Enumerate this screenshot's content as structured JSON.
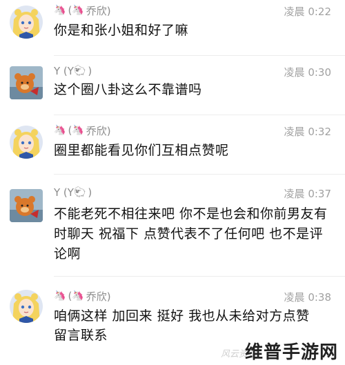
{
  "messages": [
    {
      "sender_prefix": "(",
      "sender_name": "乔欣)",
      "time": "凌晨 0:22",
      "text": "你是和张小姐和好了嘛",
      "avatar": "sailor-moon-avatar"
    },
    {
      "sender_prefix": "Y (Y",
      "sender_name": ")",
      "time": "凌晨 0:30",
      "text": "这个圈八卦这么不靠谱吗",
      "avatar": "bear-avatar"
    },
    {
      "sender_prefix": "(",
      "sender_name": "乔欣)",
      "time": "凌晨 0:32",
      "text": "圈里都能看见你们互相点赞呢",
      "avatar": "sailor-moon-avatar"
    },
    {
      "sender_prefix": "Y (Y",
      "sender_name": ")",
      "time": "凌晨 0:37",
      "text": "不能老死不相往来吧 你不是也会和你前男友有时聊天 祝福下 点赞代表不了任何吧 也不是评论啊",
      "avatar": "bear-avatar"
    },
    {
      "sender_prefix": "(",
      "sender_name": "乔欣)",
      "time": "凌晨 0:38",
      "text": "咱俩这样 加回来 挺好  我也从未给对方点赞留言联系",
      "avatar": "sailor-moon-avatar"
    }
  ],
  "watermark": "维普手游网",
  "watermark_faint": "风云资讯"
}
